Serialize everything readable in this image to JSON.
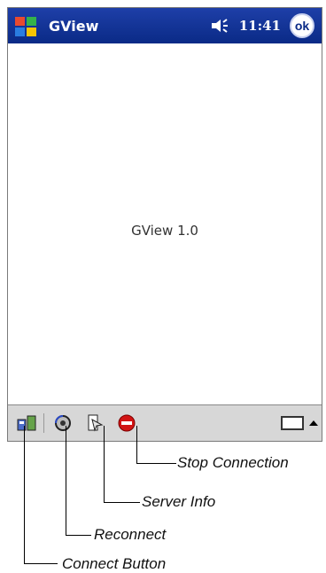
{
  "titlebar": {
    "app_title": "GView",
    "clock": "11:41",
    "ok_label": "ok"
  },
  "content": {
    "center_text": "GView 1.0"
  },
  "toolbar": {
    "icons": [
      "connect-icon",
      "reconnect-icon",
      "server-info-icon",
      "stop-connection-icon",
      "keyboard-icon"
    ]
  },
  "callouts": {
    "stop_connection": "Stop Connection",
    "server_info": "Server Info",
    "reconnect": "Reconnect",
    "connect_button": "Connect Button"
  }
}
